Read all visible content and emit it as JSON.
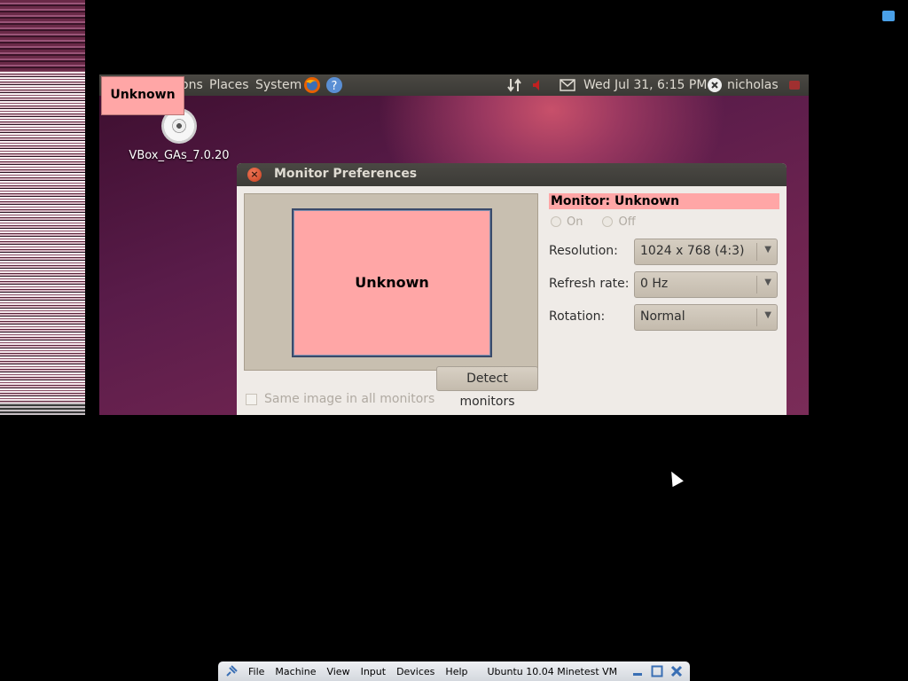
{
  "panel": {
    "menus": [
      "ons",
      "Places",
      "System"
    ],
    "clock": "Wed Jul 31,  6:15 PM",
    "user": "nicholas"
  },
  "desktop": {
    "icon_label": "VBox_GAs_7.0.20"
  },
  "overlay_label": "Unknown",
  "dialog": {
    "title": "Monitor Preferences",
    "close_glyph": "×",
    "monitor_preview_label": "Unknown",
    "same_image_label": "Same image in all monitors",
    "detect_label": "Detect monitors",
    "monitor_title": "Monitor: Unknown",
    "on_label": "On",
    "off_label": "Off",
    "resolution_label": "Resolution:",
    "resolution_value": "1024 x 768 (4:3)",
    "refresh_label": "Refresh rate:",
    "refresh_value": "0 Hz",
    "rotation_label": "Rotation:",
    "rotation_value": "Normal"
  },
  "vbox_bar": {
    "menus": [
      "File",
      "Machine",
      "View",
      "Input",
      "Devices",
      "Help"
    ],
    "vm_name": "Ubuntu 10.04 Minetest VM"
  },
  "colors": {
    "accent_pink": "#ffa6a6",
    "panel_dark": "#3c3b37"
  }
}
